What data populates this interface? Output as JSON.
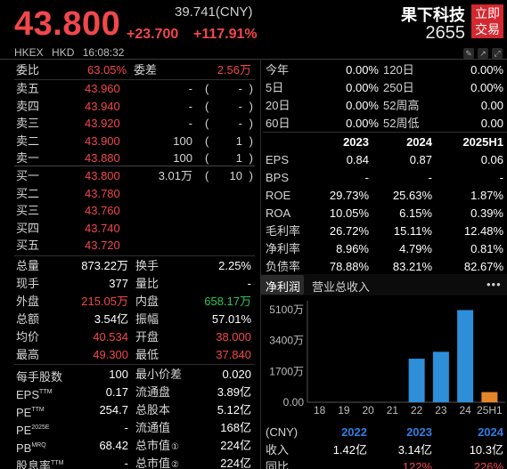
{
  "header": {
    "price": "43.800",
    "ref_price": "39.741(CNY)",
    "change": "+23.700",
    "change_pct": "+117.91%",
    "stock_name": "果下科技",
    "stock_code": "2655",
    "trade_button": "立即交易",
    "trade_button_l1": "立即",
    "trade_button_l2": "交易",
    "exchange": "HKEX",
    "currency": "HKD",
    "time": "16:08:32"
  },
  "orderbook": {
    "ratio_label": "委比",
    "ratio_value": "63.05%",
    "diff_label": "委差",
    "diff_value": "2.56万",
    "asks": [
      {
        "label": "卖五",
        "price": "43.960",
        "vol": "-",
        "open": "(",
        "cnt": "-",
        "close": ")"
      },
      {
        "label": "卖四",
        "price": "43.940",
        "vol": "-",
        "open": "(",
        "cnt": "-",
        "close": ")"
      },
      {
        "label": "卖三",
        "price": "43.920",
        "vol": "-",
        "open": "(",
        "cnt": "-",
        "close": ")"
      },
      {
        "label": "卖二",
        "price": "43.900",
        "vol": "100",
        "open": "(",
        "cnt": "1",
        "close": ")"
      },
      {
        "label": "卖一",
        "price": "43.880",
        "vol": "100",
        "open": "(",
        "cnt": "1",
        "close": ")"
      }
    ],
    "bids": [
      {
        "label": "买一",
        "price": "43.800",
        "vol": "3.01万",
        "open": "(",
        "cnt": "10",
        "close": ")"
      },
      {
        "label": "买二",
        "price": "43.780",
        "vol": "",
        "open": "",
        "cnt": "",
        "close": ""
      },
      {
        "label": "买三",
        "price": "43.760",
        "vol": "",
        "open": "",
        "cnt": "",
        "close": ""
      },
      {
        "label": "买四",
        "price": "43.740",
        "vol": "",
        "open": "",
        "cnt": "",
        "close": ""
      },
      {
        "label": "买五",
        "price": "43.720",
        "vol": "",
        "open": "",
        "cnt": "",
        "close": ""
      }
    ]
  },
  "stats": [
    {
      "l1": "总量",
      "v1": "873.22万",
      "c1": "white",
      "l2": "换手",
      "v2": "2.25%",
      "c2": "white"
    },
    {
      "l1": "现手",
      "v1": "377",
      "c1": "white",
      "l2": "量比",
      "v2": "-",
      "c2": "white"
    },
    {
      "l1": "外盘",
      "v1": "215.05万",
      "c1": "red",
      "l2": "内盘",
      "v2": "658.17万",
      "c2": "green"
    },
    {
      "l1": "总额",
      "v1": "3.54亿",
      "c1": "white",
      "l2": "振幅",
      "v2": "57.01%",
      "c2": "white"
    },
    {
      "l1": "均价",
      "v1": "40.534",
      "c1": "red",
      "l2": "开盘",
      "v2": "38.000",
      "c2": "red"
    },
    {
      "l1": "最高",
      "v1": "49.300",
      "c1": "red",
      "l2": "最低",
      "v2": "37.840",
      "c2": "red"
    }
  ],
  "stats2": [
    {
      "l1": "每手股数",
      "sup1": "",
      "v1": "100",
      "l2": "最小价差",
      "sup2": "",
      "v2": "0.020"
    },
    {
      "l1": "EPS",
      "sup1": "TTM",
      "v1": "0.17",
      "l2": "流通盘",
      "sup2": "",
      "v2": "3.89亿"
    },
    {
      "l1": "PE",
      "sup1": "TTM",
      "v1": "254.7",
      "l2": "总股本",
      "sup2": "",
      "v2": "5.12亿"
    },
    {
      "l1": "PE",
      "sup1": "2025E",
      "v1": "-",
      "l2": "流通值",
      "sup2": "",
      "v2": "168亿"
    },
    {
      "l1": "PB",
      "sup1": "MRQ",
      "v1": "68.42",
      "l2": "总市值",
      "sup2": "①",
      "v2": "224亿"
    },
    {
      "l1": "股息率",
      "sup1": "TTM",
      "v1": "-",
      "l2": "总市值",
      "sup2": "②",
      "v2": "224亿"
    }
  ],
  "perf": [
    {
      "l1": "今年",
      "v1": "0.00%",
      "l2": "120日",
      "v2": "0.00%"
    },
    {
      "l1": "5日",
      "v1": "0.00%",
      "l2": "250日",
      "v2": "0.00%"
    },
    {
      "l1": "20日",
      "v1": "0.00%",
      "l2": "52周高",
      "v2": "0.00"
    },
    {
      "l1": "60日",
      "v1": "0.00%",
      "l2": "52周低",
      "v2": "0.00"
    }
  ],
  "fin": {
    "headers": [
      "2023",
      "2024",
      "2025H1"
    ],
    "rows": [
      {
        "label": "EPS",
        "v": [
          "0.84",
          "0.87",
          "0.06"
        ]
      },
      {
        "label": "BPS",
        "v": [
          "-",
          "-",
          "-"
        ]
      },
      {
        "label": "ROE",
        "v": [
          "29.73%",
          "25.63%",
          "1.87%"
        ]
      },
      {
        "label": "ROA",
        "v": [
          "10.05%",
          "6.15%",
          "0.39%"
        ]
      },
      {
        "label": "毛利率",
        "v": [
          "26.72%",
          "15.11%",
          "12.48%"
        ]
      },
      {
        "label": "净利率",
        "v": [
          "8.96%",
          "4.79%",
          "0.81%"
        ]
      },
      {
        "label": "负债率",
        "v": [
          "78.88%",
          "83.21%",
          "82.67%"
        ]
      }
    ]
  },
  "tabs": {
    "active": "净利润",
    "other": "营业总收入",
    "more": "•••"
  },
  "chart_data": {
    "type": "bar",
    "categories": [
      "18",
      "19",
      "20",
      "21",
      "22",
      "23",
      "24",
      "25H1"
    ],
    "values": [
      0,
      0,
      0,
      0,
      2400,
      2780,
      5080,
      560
    ],
    "ytick_labels": [
      "5100万",
      "3400万",
      "1700万",
      "0.00"
    ],
    "ytick_values": [
      5100,
      3400,
      1700,
      0
    ],
    "ylim": [
      0,
      5100
    ],
    "bar_color": "#2e8ed8",
    "highlight_color": "#e5852a",
    "highlight_index": 7
  },
  "revenue_table": {
    "unit_label": "(CNY)",
    "years": [
      "2022",
      "2023",
      "2024"
    ],
    "row_label": "收入",
    "row_values": [
      "1.42亿",
      "3.14亿",
      "10.3亿"
    ],
    "row2_label": "同比",
    "row2_values": [
      "",
      "122%",
      "226%"
    ]
  },
  "colors": {
    "up": "#f2474c",
    "down": "#2fc75a",
    "accent": "#2e8ed8",
    "year_blue": "#2f7fe0"
  }
}
